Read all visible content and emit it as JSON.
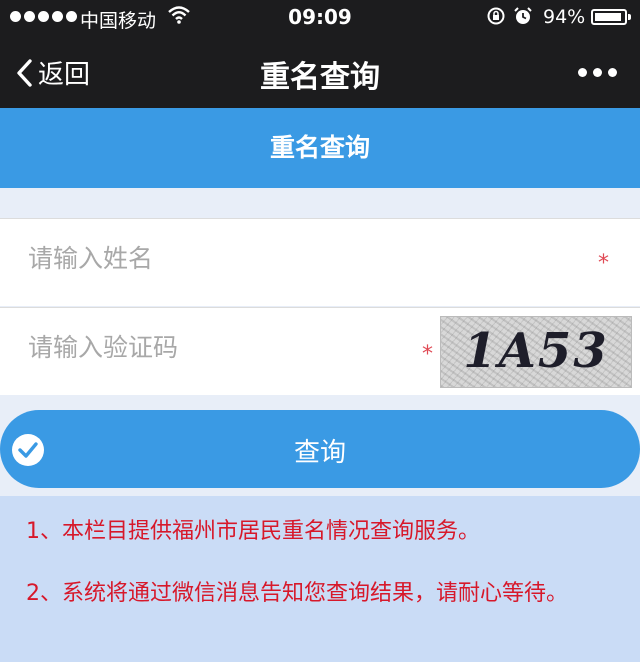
{
  "status_bar": {
    "carrier": "中国移动",
    "time": "09:09",
    "battery_percent": "94%",
    "battery_level": 0.94,
    "icons": [
      "signal-dots-icon",
      "wifi-icon",
      "rotation-lock-icon",
      "alarm-icon",
      "battery-icon"
    ]
  },
  "nav": {
    "back_label": "返回",
    "title": "重名查询",
    "icons": [
      "chevron-left-icon",
      "more-icon"
    ]
  },
  "banner": {
    "title": "重名查询"
  },
  "form": {
    "name_placeholder": "请输入姓名",
    "captcha_placeholder": "请输入验证码",
    "required_mark": "*",
    "captcha_text": "1A53"
  },
  "query_button": {
    "label": "查询",
    "icon": "check-circle-icon"
  },
  "notice": {
    "line1": "1、本栏目提供福州市居民重名情况查询服务。",
    "line2": "2、系统将通过微信消息告知您查询结果，请耐心等待。"
  },
  "colors": {
    "accent_blue": "#3a9ae4",
    "header_dark": "#1c1c1e",
    "notice_bg": "#cadcf6",
    "notice_text": "#d7182a",
    "required_red": "#e04a55"
  }
}
